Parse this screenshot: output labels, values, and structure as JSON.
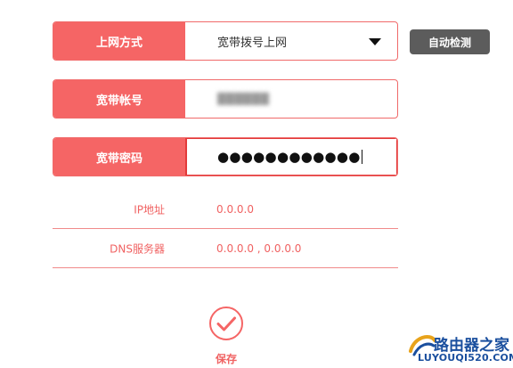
{
  "form": {
    "method": {
      "label": "上网方式",
      "value": "宽带拨号上网"
    },
    "account": {
      "label": "宽带帐号",
      "value": "██████"
    },
    "password": {
      "label": "宽带密码",
      "value": "●●●●●●●●●●●●"
    },
    "auto_detect_label": "自动检测"
  },
  "info": {
    "ip_label": "IP地址",
    "ip_value": "0.0.0.0",
    "dns_label": "DNS服务器",
    "dns_value": "0.0.0.0 , 0.0.0.0"
  },
  "save": {
    "label": "保存",
    "icon": "check-circle-icon"
  },
  "watermark": {
    "cn": "路由器之家",
    "en": "LUYOUQI520.COM"
  },
  "colors": {
    "accent": "#f56565",
    "button_dark": "#5c5c5c",
    "focus_border": "#e23a3a"
  }
}
